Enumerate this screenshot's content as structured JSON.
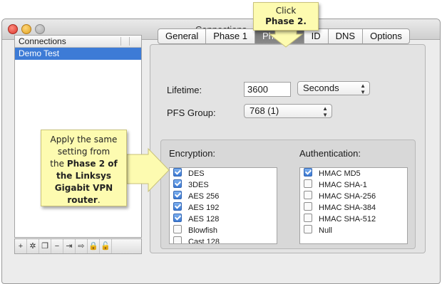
{
  "window": {
    "title": "Connections"
  },
  "sidebar": {
    "header": "Connections",
    "items": [
      {
        "label": "Demo Test",
        "selected": true
      }
    ]
  },
  "bottom_toolbar": {
    "buttons": [
      {
        "icon": "plus-icon",
        "glyph": "+"
      },
      {
        "icon": "magic-wand-icon",
        "glyph": "✲"
      },
      {
        "icon": "duplicate-icon",
        "glyph": "❐"
      },
      {
        "icon": "minus-icon",
        "glyph": "−"
      },
      {
        "icon": "import-icon",
        "glyph": "⇥"
      },
      {
        "icon": "export-icon",
        "glyph": "⇨"
      },
      {
        "icon": "lock-icon",
        "glyph": "🔒"
      },
      {
        "icon": "unlock-icon",
        "glyph": "🔓"
      }
    ]
  },
  "tabs": [
    {
      "label": "General",
      "active": false
    },
    {
      "label": "Phase 1",
      "active": false
    },
    {
      "label": "Phase 2",
      "active": true
    },
    {
      "label": "ID",
      "active": false
    },
    {
      "label": "DNS",
      "active": false
    },
    {
      "label": "Options",
      "active": false
    }
  ],
  "lifetime": {
    "label": "Lifetime:",
    "value": "3600",
    "unit": "Seconds"
  },
  "pfs": {
    "label": "PFS Group:",
    "value": "768 (1)"
  },
  "encryption": {
    "label": "Encryption:",
    "items": [
      {
        "label": "DES",
        "checked": true
      },
      {
        "label": "3DES",
        "checked": true
      },
      {
        "label": "AES 256",
        "checked": true
      },
      {
        "label": "AES 192",
        "checked": true
      },
      {
        "label": "AES 128",
        "checked": true
      },
      {
        "label": "Blowfish",
        "checked": false
      },
      {
        "label": "Cast 128",
        "checked": false
      }
    ]
  },
  "authentication": {
    "label": "Authentication:",
    "items": [
      {
        "label": "HMAC MD5",
        "checked": true
      },
      {
        "label": "HMAC SHA-1",
        "checked": false
      },
      {
        "label": "HMAC SHA-256",
        "checked": false
      },
      {
        "label": "HMAC SHA-384",
        "checked": false
      },
      {
        "label": "HMAC SHA-512",
        "checked": false
      },
      {
        "label": "Null",
        "checked": false
      }
    ]
  },
  "callouts": {
    "top": {
      "line1": "Click",
      "line2": "Phase 2."
    },
    "left": {
      "line1": "Apply the same",
      "line2": "setting from",
      "line3_pre": "the ",
      "line3_bold": "Phase 2 of",
      "line4": "the Linksys",
      "line5": "Gigabit VPN",
      "line6_bold": "router",
      "line6_post": "."
    }
  },
  "colors": {
    "selection": "#3d7bd6",
    "callout": "#fdfbb0",
    "active_tab": "#7a7a7a"
  }
}
